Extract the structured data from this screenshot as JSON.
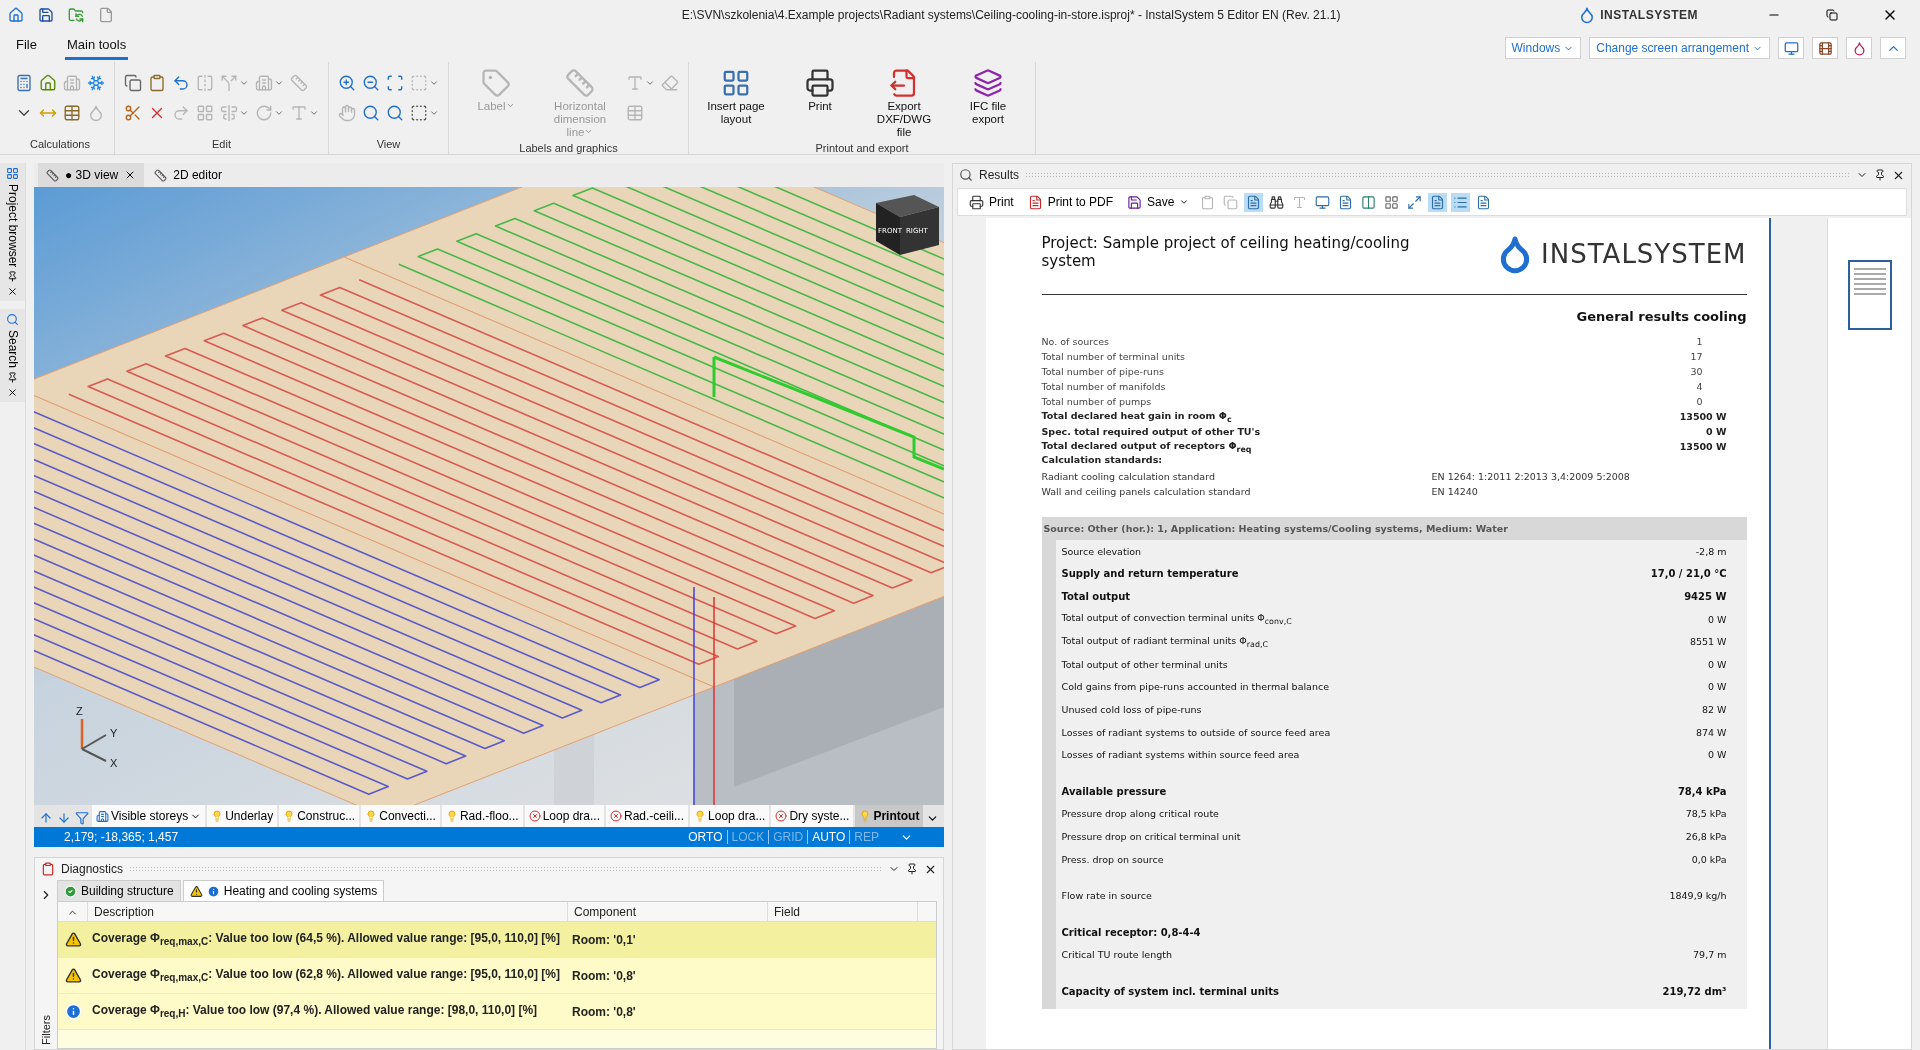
{
  "window": {
    "title": "E:\\SVN\\szkolenia\\4.Example projects\\Radiant systems\\Ceiling-cooling-in-store.isproj* - InstalSystem 5 Editor EN (Rev. 21.1)",
    "logo": "INSTALSYSTEM"
  },
  "ribbon_tabs": [
    {
      "label": "File",
      "selected": false
    },
    {
      "label": "Main tools",
      "selected": true
    }
  ],
  "ribbon_right": {
    "dropdowns": [
      "Windows",
      "Change screen arrangement"
    ]
  },
  "ribbon": [
    {
      "label": "Calculations",
      "tools": [
        {
          "kind": "calculator",
          "disabled": false,
          "dropdown": false
        },
        {
          "kind": "caret",
          "disabled": false,
          "dropdown": false
        },
        {
          "kind": "house",
          "disabled": false,
          "dropdown": false
        },
        {
          "kind": "pipe",
          "disabled": false,
          "dropdown": false
        },
        {
          "kind": "building",
          "disabled": true,
          "dropdown": false
        },
        {
          "kind": "table",
          "disabled": false,
          "dropdown": false
        },
        {
          "kind": "snowflake",
          "disabled": false,
          "dropdown": false
        },
        {
          "kind": "drop",
          "disabled": true,
          "dropdown": false
        }
      ]
    },
    {
      "label": "Edit",
      "tools": [
        {
          "kind": "copy",
          "disabled": false,
          "dropdown": false
        },
        {
          "kind": "scissors",
          "disabled": false,
          "dropdown": false
        },
        {
          "kind": "paste",
          "disabled": false,
          "dropdown": false
        },
        {
          "kind": "delete",
          "disabled": false,
          "dropdown": false
        },
        {
          "kind": "undo",
          "disabled": false,
          "dropdown": false
        },
        {
          "kind": "redo",
          "disabled": true,
          "dropdown": false
        },
        {
          "kind": "mirror",
          "disabled": true,
          "dropdown": false
        },
        {
          "kind": "grid",
          "disabled": true,
          "dropdown": false
        },
        {
          "kind": "split",
          "disabled": true,
          "dropdown": true
        },
        {
          "kind": "align",
          "disabled": true,
          "dropdown": true
        },
        {
          "kind": "building",
          "disabled": true,
          "dropdown": true
        },
        {
          "kind": "rotate",
          "disabled": true,
          "dropdown": true
        },
        {
          "kind": "ruler",
          "disabled": true,
          "dropdown": false
        },
        {
          "kind": "text",
          "disabled": true,
          "dropdown": true
        }
      ]
    },
    {
      "label": "View",
      "tools": [
        {
          "kind": "zoom-in",
          "disabled": false,
          "dropdown": false
        },
        {
          "kind": "hand",
          "disabled": true,
          "dropdown": false
        },
        {
          "kind": "zoom-out",
          "disabled": false,
          "dropdown": false
        },
        {
          "kind": "zoom",
          "disabled": false,
          "dropdown": false
        },
        {
          "kind": "zoom-text",
          "disabled": false,
          "dropdown": false
        },
        {
          "kind": "zoom",
          "disabled": false,
          "dropdown": false
        },
        {
          "kind": "select",
          "disabled": true,
          "dropdown": true
        },
        {
          "kind": "select",
          "disabled": false,
          "dropdown": true
        }
      ]
    },
    {
      "label": "Labels and graphics",
      "buttons": [
        {
          "label": "Label",
          "kind": "label",
          "disabled": true,
          "dropdown": true
        },
        {
          "label": "Horizontal dimension line",
          "kind": "dimension",
          "disabled": true,
          "dropdown": true
        }
      ],
      "tools_after": [
        {
          "kind": "text",
          "disabled": true,
          "dropdown": true
        },
        {
          "kind": "table",
          "disabled": true,
          "dropdown": false
        },
        {
          "kind": "eraser",
          "disabled": true,
          "dropdown": false
        }
      ]
    },
    {
      "label": "Printout and export",
      "buttons": [
        {
          "label": "Insert page layout",
          "kind": "layout",
          "disabled": false,
          "dropdown": false
        },
        {
          "label": "Print",
          "kind": "printer",
          "disabled": false,
          "dropdown": false
        },
        {
          "label": "Export DXF/DWG file",
          "kind": "export",
          "disabled": false,
          "dropdown": false
        },
        {
          "label": "IFC file export",
          "kind": "ifc",
          "disabled": false,
          "dropdown": false
        }
      ]
    }
  ],
  "side_panels": [
    {
      "label": "Project browser",
      "kind": "browser"
    },
    {
      "label": "Search",
      "kind": "search"
    }
  ],
  "view_tabs": [
    {
      "label": "● 3D view",
      "selected": true,
      "closable": true
    },
    {
      "label": "2D editor",
      "selected": false,
      "closable": false
    }
  ],
  "viewport": {
    "view_cube": [
      "FRONT",
      "RIGHT"
    ],
    "axes": [
      "Z",
      "Y",
      "X"
    ]
  },
  "layers": {
    "storeys": "Visible storeys",
    "items": [
      {
        "label": "Underlay",
        "visible": true,
        "selected": false
      },
      {
        "label": "Construc...",
        "visible": true,
        "selected": false
      },
      {
        "label": "Convecti...",
        "visible": true,
        "selected": false
      },
      {
        "label": "Rad.-floo...",
        "visible": true,
        "selected": false
      },
      {
        "label": "Loop dra...",
        "visible": false,
        "selected": false
      },
      {
        "label": "Rad.-ceili...",
        "visible": false,
        "selected": false
      },
      {
        "label": "Loop dra...",
        "visible": true,
        "selected": false
      },
      {
        "label": "Dry syste...",
        "visible": false,
        "selected": false
      },
      {
        "label": "Printout",
        "visible": true,
        "selected": true
      }
    ]
  },
  "status_bar": {
    "coordinates": "2,179; -18,365; 1,457",
    "toggles": [
      {
        "label": "ORTO",
        "on": true
      },
      {
        "label": "LOCK",
        "on": false
      },
      {
        "label": "GRID",
        "on": false
      },
      {
        "label": "AUTO",
        "on": true
      },
      {
        "label": "REP",
        "on": false
      }
    ]
  },
  "diagnostics": {
    "title": "Diagnostics",
    "filters": "Filters",
    "tabs": [
      {
        "label": "Building structure",
        "kind": "ok",
        "selected": false
      },
      {
        "label": "Heating and cooling systems",
        "kind": "warning",
        "selected": true
      }
    ],
    "columns": [
      "Description",
      "Component",
      "Field"
    ],
    "rows": [
      {
        "kind": "warning",
        "selected": true,
        "description": "Coverage Φ$_{req,max,C}$: Value too low (64,5 %). Allowed value range: [95,0, 110,0] [%]",
        "component": "Room: '0,1'"
      },
      {
        "kind": "warning",
        "selected": false,
        "description": "Coverage Φ$_{req,max,C}$: Value too low (62,8 %). Allowed value range: [95,0, 110,0] [%]",
        "component": "Room: '0,8'"
      },
      {
        "kind": "info",
        "selected": false,
        "description": "Coverage Φ$_{req,H}$: Value too low (97,4 %). Allowed value range: [98,0, 110,0] [%]",
        "component": "Room: '0,8'"
      }
    ]
  },
  "results": {
    "title": "Results",
    "toolbar": [
      {
        "label": "Print",
        "kind": "printer",
        "dropdown": false
      },
      {
        "label": "Print to PDF",
        "kind": "pdf",
        "dropdown": false
      },
      {
        "label": "Save",
        "kind": "save",
        "dropdown": true
      }
    ],
    "view_buttons": [
      {
        "kind": "clipboard",
        "pressed": false,
        "disabled": true
      },
      {
        "kind": "copy",
        "pressed": false,
        "disabled": true
      },
      {
        "kind": "page",
        "pressed": true,
        "disabled": false
      },
      {
        "kind": "binoculars",
        "pressed": false,
        "disabled": false
      },
      {
        "kind": "text",
        "pressed": false,
        "disabled": true
      },
      {
        "kind": "monitor",
        "pressed": false,
        "disabled": false
      },
      {
        "kind": "page",
        "pressed": false,
        "disabled": false
      },
      {
        "kind": "columns",
        "pressed": false,
        "disabled": false
      },
      {
        "kind": "grid",
        "pressed": false,
        "disabled": false
      },
      {
        "kind": "fit",
        "pressed": false,
        "disabled": false
      },
      {
        "kind": "page",
        "pressed": true,
        "disabled": false
      },
      {
        "kind": "list",
        "pressed": true,
        "disabled": false
      },
      {
        "kind": "page",
        "pressed": false,
        "disabled": false
      }
    ],
    "document": {
      "project": "Project: Sample project of ceiling heating/cooling system",
      "logo": "INSTALSYSTEM",
      "heading": "General results cooling",
      "summary": [
        {
          "label": "No. of sources",
          "value": "1",
          "bold": false
        },
        {
          "label": "Total number of terminal units",
          "value": "17",
          "bold": false
        },
        {
          "label": "Total number of pipe-runs",
          "value": "30",
          "bold": false
        },
        {
          "label": "Total number of manifolds",
          "value": "4",
          "bold": false
        },
        {
          "label": "Total number of pumps",
          "value": "0",
          "bold": false
        },
        {
          "label": "Total declared heat gain in room Φ$_{c}$",
          "value": "13500 W",
          "bold": true
        },
        {
          "label": "Spec. total required output of other TU's",
          "value": "0 W",
          "bold": true
        },
        {
          "label": "Total declared output of receptors Φ$_{req}$",
          "value": "13500 W",
          "bold": true
        }
      ],
      "standards_heading": "Calculation standards:",
      "standards": [
        {
          "label": "Radiant cooling calculation standard",
          "value": "EN 1264: 1:2011 2:2013 3,4:2009 5:2008"
        },
        {
          "label": "Wall and ceiling panels calculation standard",
          "value": "EN 14240"
        }
      ],
      "source_header": "Source: Other (hor.): 1, Application: Heating systems/Cooling systems, Medium: Water",
      "source_groups": [
        [
          {
            "label": "Source elevation",
            "value": "-2,8 m",
            "bold": false
          },
          {
            "label": "Supply and return temperature",
            "value": "17,0 / 21,0 °C",
            "bold": true
          },
          {
            "label": "Total output",
            "value": "9425 W",
            "bold": true
          },
          {
            "label": "Total output of convection terminal units Φ$_{conv,C}$",
            "value": "0 W",
            "bold": false
          },
          {
            "label": "Total output of radiant terminal units Φ$_{rad,C}$",
            "value": "8551 W",
            "bold": false
          },
          {
            "label": "Total output of other terminal units",
            "value": "0 W",
            "bold": false
          },
          {
            "label": "Cold gains from pipe-runs accounted in thermal balance",
            "value": "0 W",
            "bold": false
          },
          {
            "label": "Unused cold loss of pipe-runs",
            "value": "82 W",
            "bold": false
          },
          {
            "label": "Losses of radiant systems to outside of source feed area",
            "value": "874 W",
            "bold": false
          },
          {
            "label": "Losses of radiant systems within source feed area",
            "value": "0 W",
            "bold": false
          }
        ],
        [
          {
            "label": "Available pressure",
            "value": "78,4 kPa",
            "bold": true
          },
          {
            "label": "Pressure drop along critical route",
            "value": "78,5 kPa",
            "bold": false
          },
          {
            "label": "Pressure drop on critical terminal unit",
            "value": "26,8 kPa",
            "bold": false
          },
          {
            "label": "Press. drop on source",
            "value": "0,0 kPa",
            "bold": false
          }
        ],
        [
          {
            "label": "Flow rate in source",
            "value": "1849,9 kg/h",
            "bold": false
          }
        ],
        [
          {
            "label": "Critical receptor:  0,8-4-4",
            "bold": true
          },
          {
            "label": "Critical TU route length",
            "value": "79,7 m",
            "bold": false
          }
        ],
        [
          {
            "label": "Capacity of system incl. terminal units",
            "value": "219,72 dm³",
            "bold": true
          }
        ]
      ]
    },
    "thumbnails": [
      {
        "selected": true
      }
    ]
  }
}
